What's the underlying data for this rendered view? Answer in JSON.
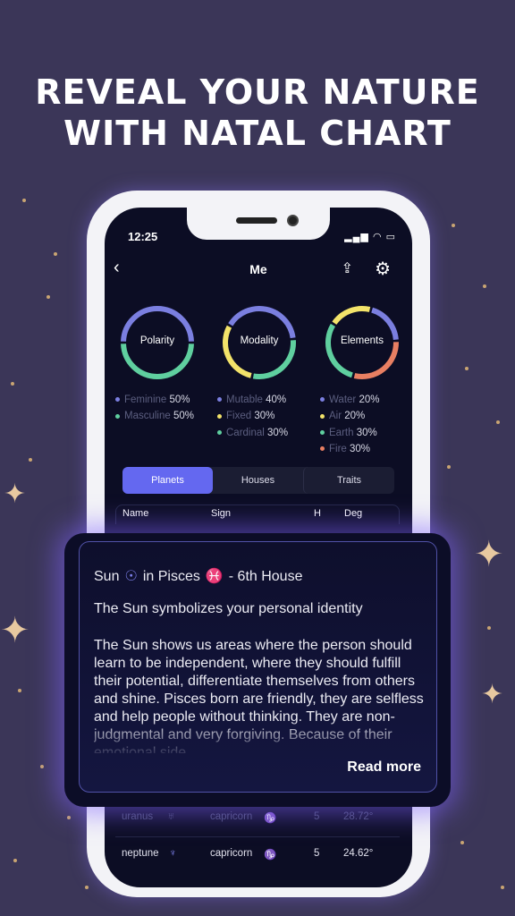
{
  "headline": {
    "line1": "REVEAL YOUR NATURE",
    "line2": "WITH NATAL CHART"
  },
  "status": {
    "time": "12:25",
    "icons": "signal-wifi-battery"
  },
  "nav": {
    "title": "Me",
    "back_icon": "chevron-left-icon",
    "share_icon": "share-icon",
    "settings_icon": "gear-icon"
  },
  "colors": {
    "purple": "#7b7fe0",
    "green": "#5fcf9f",
    "yellow": "#f3e36a",
    "orange": "#e87f62",
    "accent": "#6468f0"
  },
  "rings": [
    {
      "label": "Polarity",
      "items": [
        {
          "name": "Feminine",
          "value": "50%",
          "pct": 50,
          "color": "#7b7fe0"
        },
        {
          "name": "Masculine",
          "value": "50%",
          "pct": 50,
          "color": "#5fcf9f"
        }
      ]
    },
    {
      "label": "Modality",
      "items": [
        {
          "name": "Mutable",
          "value": "40%",
          "pct": 40,
          "color": "#7b7fe0"
        },
        {
          "name": "Fixed",
          "value": "30%",
          "pct": 30,
          "color": "#f3e36a"
        },
        {
          "name": "Cardinal",
          "value": "30%",
          "pct": 30,
          "color": "#5fcf9f"
        }
      ]
    },
    {
      "label": "Elements",
      "items": [
        {
          "name": "Water",
          "value": "20%",
          "pct": 20,
          "color": "#7b7fe0"
        },
        {
          "name": "Air",
          "value": "20%",
          "pct": 20,
          "color": "#f3e36a"
        },
        {
          "name": "Earth",
          "value": "30%",
          "pct": 30,
          "color": "#5fcf9f"
        },
        {
          "name": "Fire",
          "value": "30%",
          "pct": 30,
          "color": "#e87f62"
        }
      ]
    }
  ],
  "tabs": [
    {
      "label": "Planets",
      "active": true
    },
    {
      "label": "Houses"
    },
    {
      "label": "Traits"
    }
  ],
  "table": {
    "headers": [
      "Name",
      "Sign",
      "H",
      "Deg"
    ],
    "rows": [
      {
        "name": "uranus",
        "name_sym": "♅",
        "sign": "capricorn",
        "sign_sym": "♑",
        "h": "5",
        "deg": "28.72°"
      },
      {
        "name": "neptune",
        "name_sym": "♆",
        "sign": "capricorn",
        "sign_sym": "♑",
        "h": "5",
        "deg": "24.62°"
      }
    ]
  },
  "popup": {
    "planet": "Sun",
    "planet_sym": "☉",
    "sign_text": "in Pisces",
    "sign_sym": "♓",
    "house_text": "- 6th House",
    "subtitle": "The Sun symbolizes your personal identity",
    "body": "The Sun shows us areas where the person should learn to be independent, where they should fulfill their potential, differentiate themselves from others and shine. Pisces born are friendly, they are selfless and help people without thinking. They are non-judgmental and very forgiving. Because of their emotional side,",
    "read_more": "Read more"
  }
}
